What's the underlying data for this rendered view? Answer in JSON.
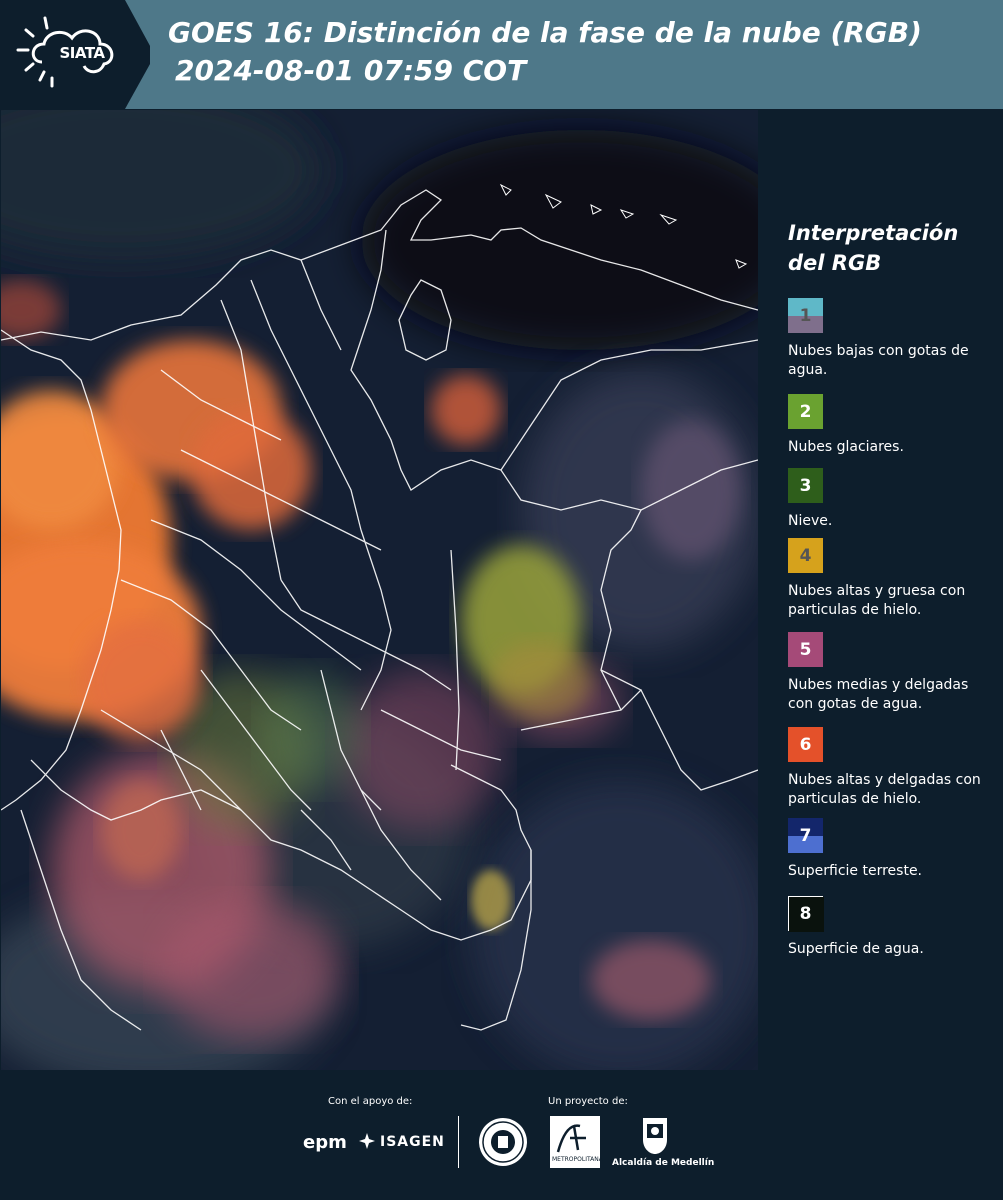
{
  "header": {
    "logo_text": "SIATA",
    "title_line1": "GOES 16: Distinción de la fase de la nube (RGB)",
    "title_line2": "2024-08-01 07:59 COT"
  },
  "legend": {
    "title_line1": "Interpretación",
    "title_line2": "del RGB",
    "items": [
      {
        "num": "1",
        "label": "Nubes bajas con gotas de agua.",
        "color_top": "#5fb8c8",
        "color_bottom": "#7f6f8c",
        "num_color": "#555555"
      },
      {
        "num": "2",
        "label": "Nubes glaciares.",
        "color_top": "#6aa230",
        "color_bottom": "#6aa230",
        "num_color": "#ffffff"
      },
      {
        "num": "3",
        "label": "Nieve.",
        "color_top": "#2e5e1b",
        "color_bottom": "#2e5e1b",
        "num_color": "#ffffff"
      },
      {
        "num": "4",
        "label": "Nubes altas y gruesa con particulas de hielo.",
        "color_top": "#d6a21c",
        "color_bottom": "#d6a21c",
        "num_color": "#555555"
      },
      {
        "num": "5",
        "label": "Nubes medias y delgadas con gotas de agua.",
        "color_top": "#a54a78",
        "color_bottom": "#a54a78",
        "num_color": "#ffffff"
      },
      {
        "num": "6",
        "label": "Nubes altas y delgadas con particulas de hielo.",
        "color_top": "#e4512a",
        "color_bottom": "#e4512a",
        "num_color": "#ffffff"
      },
      {
        "num": "7",
        "label": "Superficie terreste.",
        "color_top": "#13266b",
        "color_bottom": "#4d6fd0",
        "num_color": "#ffffff"
      },
      {
        "num": "8",
        "label": "Superficie de agua.",
        "color_top": "#0a120d",
        "color_bottom": "#0a120d",
        "num_color": "#ffffff"
      }
    ]
  },
  "footer": {
    "support_label": "Con el apoyo de:",
    "project_label": "Un proyecto de:",
    "epm": "epm",
    "isagen": "ISAGEN",
    "area_logo_text": "METROPOLITANA",
    "alcaldia": "Alcaldía de Medellín"
  }
}
